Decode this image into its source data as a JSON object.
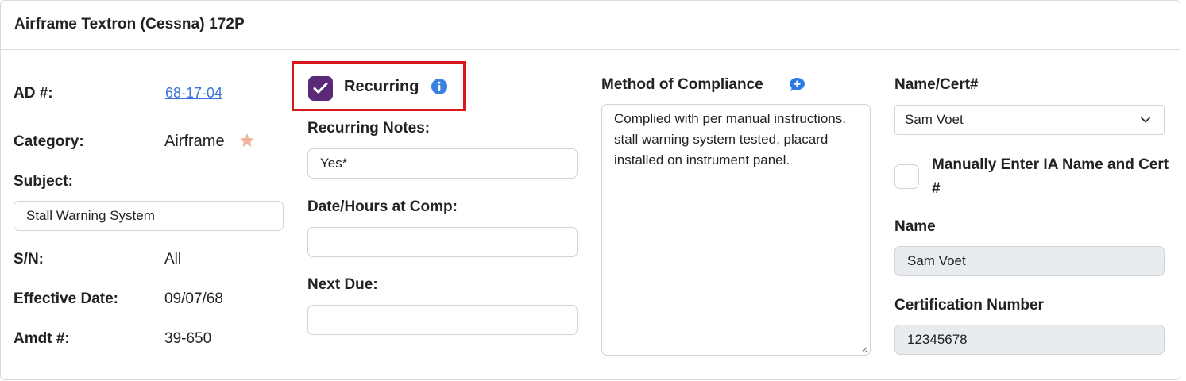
{
  "header": {
    "title": "Airframe Textron (Cessna) 172P"
  },
  "left": {
    "ad_label": "AD #:",
    "ad_value": "68-17-04",
    "category_label": "Category:",
    "category_value": "Airframe",
    "subject_label": "Subject:",
    "subject_value": "Stall Warning System",
    "sn_label": "S/N:",
    "sn_value": "All",
    "effective_label": "Effective Date:",
    "effective_value": "09/07/68",
    "amdt_label": "Amdt #:",
    "amdt_value": "39-650"
  },
  "middle": {
    "recurring_label": "Recurring",
    "recurring_checked": true,
    "recurring_notes_label": "Recurring Notes:",
    "recurring_notes_value": "Yes*",
    "date_hours_label": "Date/Hours at Comp:",
    "date_hours_value": "",
    "next_due_label": "Next Due:",
    "next_due_value": ""
  },
  "compliance": {
    "label": "Method of Compliance",
    "text": "Complied with per manual instructions. stall warning system tested, placard installed on instrument panel."
  },
  "right": {
    "name_cert_label": "Name/Cert#",
    "name_cert_selected": "Sam Voet",
    "manual_label": "Manually Enter IA Name and Cert #",
    "manual_checked": false,
    "name_label": "Name",
    "name_value": "Sam Voet",
    "cert_label": "Certification Number",
    "cert_value": "12345678"
  },
  "colors": {
    "accent_purple": "#5a2a79",
    "highlight_red": "#d9161c",
    "link_blue": "#3b73d6",
    "star": "#f0b39c",
    "info_blue": "#3b82e0"
  },
  "icons": {
    "star": "star-icon",
    "info": "info-icon",
    "comment": "comment-plus-icon",
    "chevron": "chevron-down-icon",
    "check": "check-icon"
  }
}
